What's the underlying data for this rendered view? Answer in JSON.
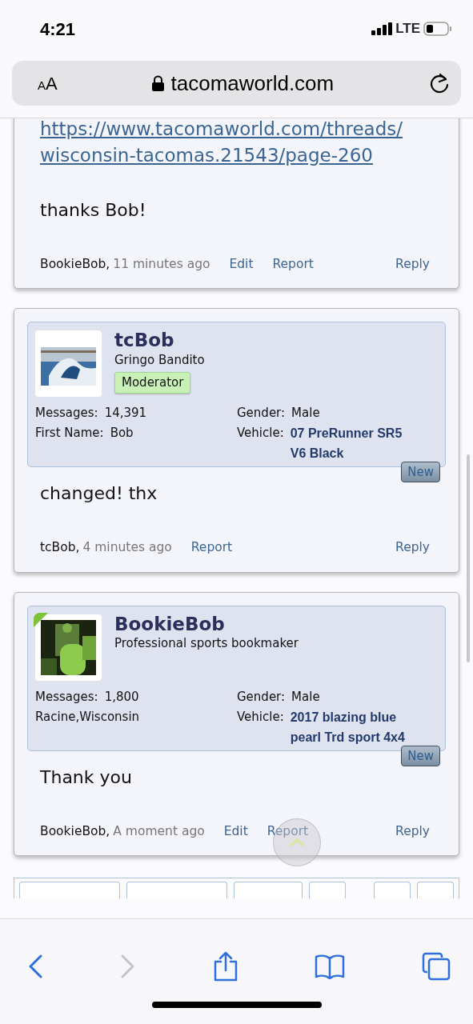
{
  "status_bar": {
    "time": "4:21",
    "network": "LTE"
  },
  "address_bar": {
    "text_size_button": "AA",
    "url": "tacomaworld.com"
  },
  "posts": [
    {
      "body": [
        {
          "kind": "link",
          "text": "https://www.tacomaworld.com/threads/"
        },
        {
          "kind": "link",
          "text": "wisconsin-tacomas.21543/page-260"
        },
        {
          "kind": "text",
          "text": "thanks Bob!"
        }
      ],
      "footer": {
        "author": "BookieBob,",
        "time": "11 minutes ago",
        "actions": [
          "Edit",
          "Report"
        ],
        "reply": "Reply"
      }
    },
    {
      "profile": {
        "name": "tcBob",
        "title": "Gringo Bandito",
        "badge": "Moderator",
        "online": false,
        "left_stats": [
          {
            "label": "Messages:",
            "value": "14,391"
          },
          {
            "label": "First Name:",
            "value": "Bob"
          }
        ],
        "right_stats": [
          {
            "label": "Gender:",
            "value": "Male",
            "kind": "plain"
          },
          {
            "label": "Vehicle:",
            "value": "07 PreRunner SR5 V6 Black",
            "kind": "vehicle"
          }
        ],
        "new_button": "New"
      },
      "body": [
        {
          "kind": "text",
          "text": "changed! thx"
        }
      ],
      "footer": {
        "author": "tcBob,",
        "time": "4 minutes ago",
        "actions": [
          "Report"
        ],
        "reply": "Reply"
      }
    },
    {
      "profile": {
        "name": "BookieBob",
        "title": "Professional sports bookmaker",
        "online": true,
        "left_stats": [
          {
            "label": "Messages:",
            "value": "1,800"
          },
          {
            "value": "Racine,Wisconsin"
          }
        ],
        "right_stats": [
          {
            "label": "Gender:",
            "value": "Male",
            "kind": "plain"
          },
          {
            "label": "Vehicle:",
            "value": "2017 blazing blue pearl Trd sport 4x4",
            "kind": "vehicle"
          }
        ],
        "new_button": "New"
      },
      "body": [
        {
          "kind": "text",
          "text": "Thank you"
        }
      ],
      "footer": {
        "author": "BookieBob,",
        "time": "A moment ago",
        "actions": [
          "Edit",
          "Report"
        ],
        "reply": "Reply"
      }
    }
  ],
  "browser_toolbar": {
    "back_enabled": true,
    "forward_enabled": false
  }
}
